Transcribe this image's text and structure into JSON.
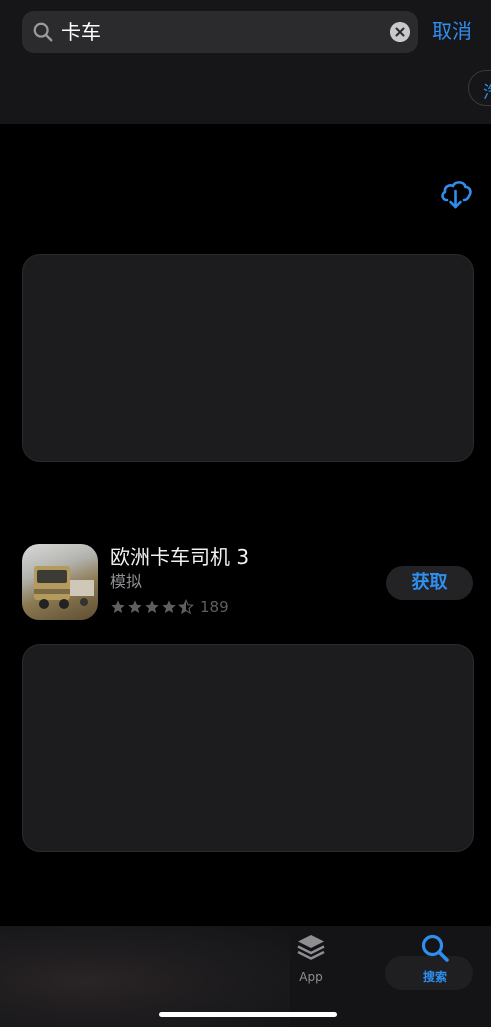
{
  "search": {
    "query": "卡车",
    "cancel_label": "取消",
    "partial_chip_label": "汽"
  },
  "app": {
    "title": "欧洲卡车司机 3",
    "category": "模拟",
    "rating": 4.5,
    "rating_count": "189",
    "get_label": "获取"
  },
  "tab_bar": {
    "app_label": "App",
    "search_label": "搜索"
  },
  "colors": {
    "accent": "#2e8ff0",
    "background": "#000000",
    "card": "#1c1c1e"
  },
  "icons": [
    "search-icon",
    "clear-icon",
    "cloud-download-icon",
    "star-icon",
    "layers-icon"
  ]
}
